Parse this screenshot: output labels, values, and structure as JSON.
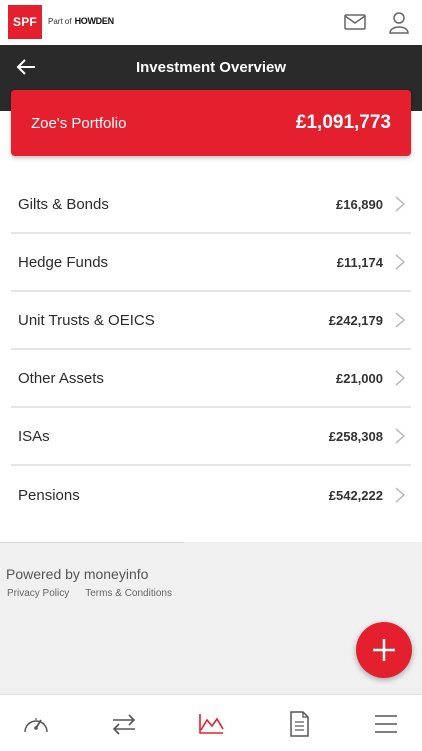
{
  "header": {
    "logo_text": "SPF",
    "part_of_text": "Part of",
    "brand_text": "HOWDEN"
  },
  "titlebar": {
    "title": "Investment Overview"
  },
  "portfolio": {
    "name": "Zoe's Portfolio",
    "total": "£1,091,773"
  },
  "investments": [
    {
      "label": "Gilts & Bonds",
      "amount": "£16,890"
    },
    {
      "label": "Hedge Funds",
      "amount": "£11,174"
    },
    {
      "label": "Unit Trusts & OEICS",
      "amount": "£242,179"
    },
    {
      "label": "Other Assets",
      "amount": "£21,000"
    },
    {
      "label": "ISAs",
      "amount": "£258,308"
    },
    {
      "label": "Pensions",
      "amount": "£542,222"
    }
  ],
  "footer": {
    "powered_by": "Powered by moneyinfo",
    "privacy_link": "Privacy Policy",
    "terms_link": "Terms & Conditions"
  },
  "bottom_nav": [
    {
      "icon": "dashboard-icon",
      "active": false
    },
    {
      "icon": "transfer-icon",
      "active": false
    },
    {
      "icon": "chart-icon",
      "active": true
    },
    {
      "icon": "document-icon",
      "active": false
    },
    {
      "icon": "menu-icon",
      "active": false
    }
  ],
  "colors": {
    "brand_red": "#e5202e",
    "titlebar_dark": "#2a2a2a",
    "footer_grey": "#f0f0f0"
  }
}
